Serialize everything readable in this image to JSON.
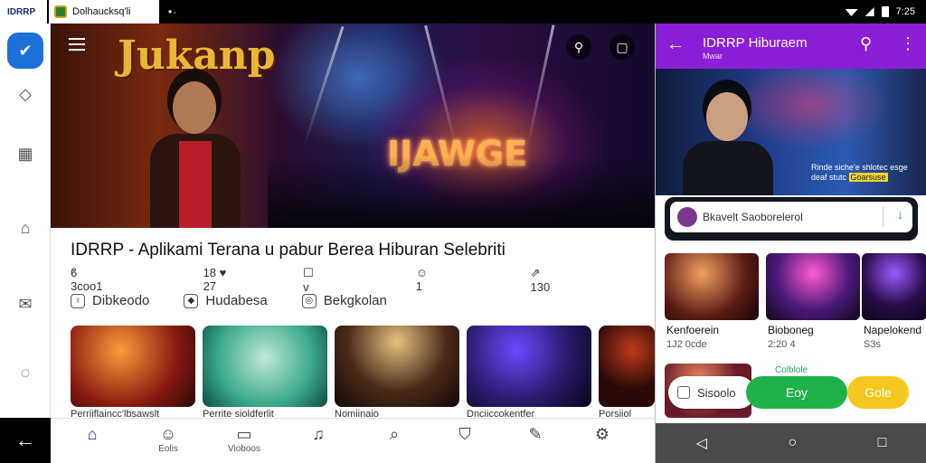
{
  "status": {
    "tab1_label": "IDRRP",
    "tab2_label": "Dolhaucksq'li",
    "time": "7:25"
  },
  "rail": {
    "items": [
      {
        "name": "shield-check-icon",
        "glyph": "✔"
      },
      {
        "name": "diamond-icon",
        "glyph": "◇"
      },
      {
        "name": "calendar-icon",
        "glyph": "▦"
      },
      {
        "name": "home-outline-icon",
        "glyph": "⌂"
      },
      {
        "name": "mail-icon",
        "glyph": "✉"
      },
      {
        "name": "chat-icon",
        "glyph": "◌"
      }
    ],
    "back_glyph": "←"
  },
  "hero": {
    "title": "Jukanp",
    "sign": "IJAWGE"
  },
  "info": {
    "title": "IDRRP - Aplikami Terana u pabur Berea Hiburan Selebriti",
    "meta": [
      {
        "icon": "ϐ",
        "text": "3coo1"
      },
      {
        "icon": "",
        "text": "18 ♥ 27"
      },
      {
        "icon": "☐",
        "text": "v"
      },
      {
        "icon": "☺",
        "text": "1"
      },
      {
        "icon": "⇗",
        "text": "130"
      }
    ],
    "chips": [
      {
        "icon": "♀",
        "label": "Dibkeodo"
      },
      {
        "icon": "◆",
        "label": "Hudabesa"
      },
      {
        "icon": "◎",
        "label": "Bekgkolan"
      }
    ],
    "thumb_captions": [
      "Perriiflaincc'lbsawslt",
      "Perrite sioldferlit",
      "Nomiinaio",
      "Dnciiccokentfer",
      "Porsiiol"
    ]
  },
  "bottom_nav": [
    {
      "name": "home",
      "glyph": "⌂",
      "label": ""
    },
    {
      "name": "profile",
      "glyph": "☺",
      "label": "Eolis"
    },
    {
      "name": "videos",
      "glyph": "▭",
      "label": "Vioboos"
    },
    {
      "name": "music",
      "glyph": "♫",
      "label": ""
    },
    {
      "name": "search",
      "glyph": "⌕",
      "label": ""
    },
    {
      "name": "shield",
      "glyph": "⛉",
      "label": ""
    },
    {
      "name": "edit",
      "glyph": "✎",
      "label": ""
    },
    {
      "name": "settings",
      "glyph": "⚙",
      "label": ""
    }
  ],
  "panel": {
    "back_glyph": "←",
    "title": "IDRRP Hiburaem",
    "subtitle": "Mwar",
    "search_glyph": "⚲",
    "more_glyph": "⋮",
    "hero_caption": "Rinde siche'e shlotec esge deaf stutc",
    "hero_caption_highlight": "Goarsuse",
    "download_text": "Bkavelt Saoborelerol",
    "download_arrow": "↓",
    "cards": [
      {
        "name": "Kenfoerein",
        "sub": "1J2 0cde"
      },
      {
        "name": "Bioboneg",
        "sub": "2:20 4"
      },
      {
        "name": "Napelokend",
        "sub": "S3s"
      }
    ],
    "lower_card_label": "Colblole",
    "stream_label": "Sisoolo",
    "buy_label": "Eoy",
    "gold_label": "Gole",
    "nav": [
      "◁",
      "○",
      "□"
    ]
  },
  "colors": {
    "accent_purple": "#8b1fd8",
    "rail_active": "#1e6fd8",
    "buy_green": "#1fb24a",
    "gold": "#f4c81e"
  }
}
